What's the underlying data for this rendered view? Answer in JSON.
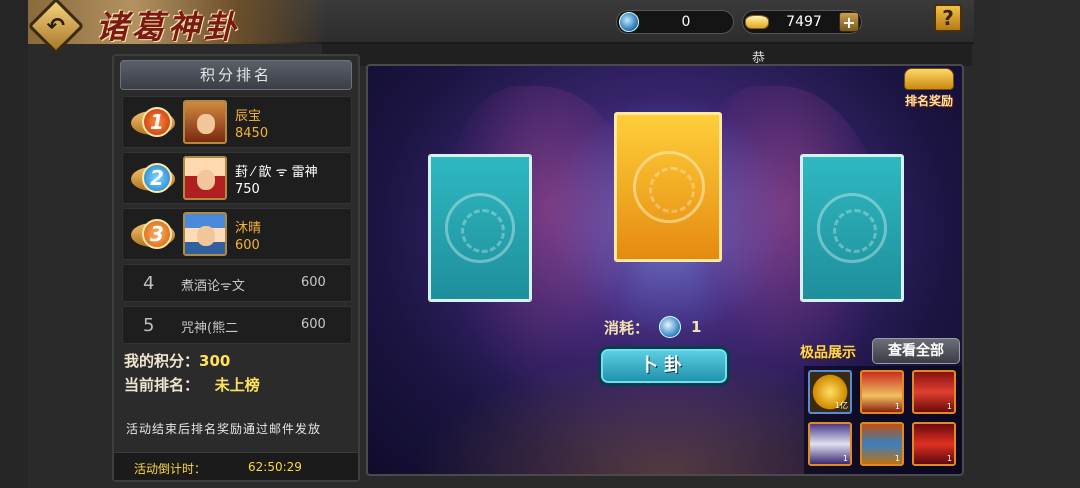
{
  "header": {
    "title": "诸葛神卦",
    "yin_count": "0",
    "gold_count": "7497",
    "plus_label": "+",
    "help_label": "?"
  },
  "marquee": {
    "text": "恭"
  },
  "ranking": {
    "title": "积分排名",
    "top": [
      {
        "rank": "1",
        "name": "辰宝",
        "score": "8450",
        "name_color": "#f5b335"
      },
      {
        "rank": "2",
        "name": "葑 ⁄ 歆 ᯤ 雷神",
        "score": "750",
        "name_color": "#ffffff"
      },
      {
        "rank": "3",
        "name": "沐晴",
        "score": "600",
        "name_color": "#f5b335"
      }
    ],
    "others": [
      {
        "rank": "4",
        "name": "煮酒论ᯤ文",
        "score": "600"
      },
      {
        "rank": "5",
        "name": "咒神(熊二",
        "score": "600"
      }
    ]
  },
  "my_info": {
    "score_label": "我的积分：",
    "score_value": "300",
    "rank_label": "当前排名：",
    "rank_value": "未上榜"
  },
  "note": "活动结束后排名奖励通过邮件发放",
  "countdown": {
    "label": "活动倒计时：",
    "time": "62:50:29"
  },
  "main": {
    "reward_label": "排名奖励",
    "cost_label": "消耗：",
    "cost_value": "1",
    "divine_button": "卜卦",
    "showcase_title": "极品展示",
    "view_all_button": "查看全部",
    "items": [
      {
        "name": "gold-coin",
        "qty": "1亿"
      },
      {
        "name": "hero-fragment",
        "qty": "1"
      },
      {
        "name": "hero-fragment",
        "qty": "1"
      },
      {
        "name": "hero-fragment",
        "qty": "1"
      },
      {
        "name": "hero-fragment",
        "qty": "1"
      },
      {
        "name": "hero-fragment",
        "qty": "1"
      }
    ]
  },
  "colors": {
    "accent_gold": "#f5b335",
    "button_cyan": "#1c8ea8",
    "card_cyan": "#2fb8c0",
    "card_orange": "#e58a10"
  }
}
